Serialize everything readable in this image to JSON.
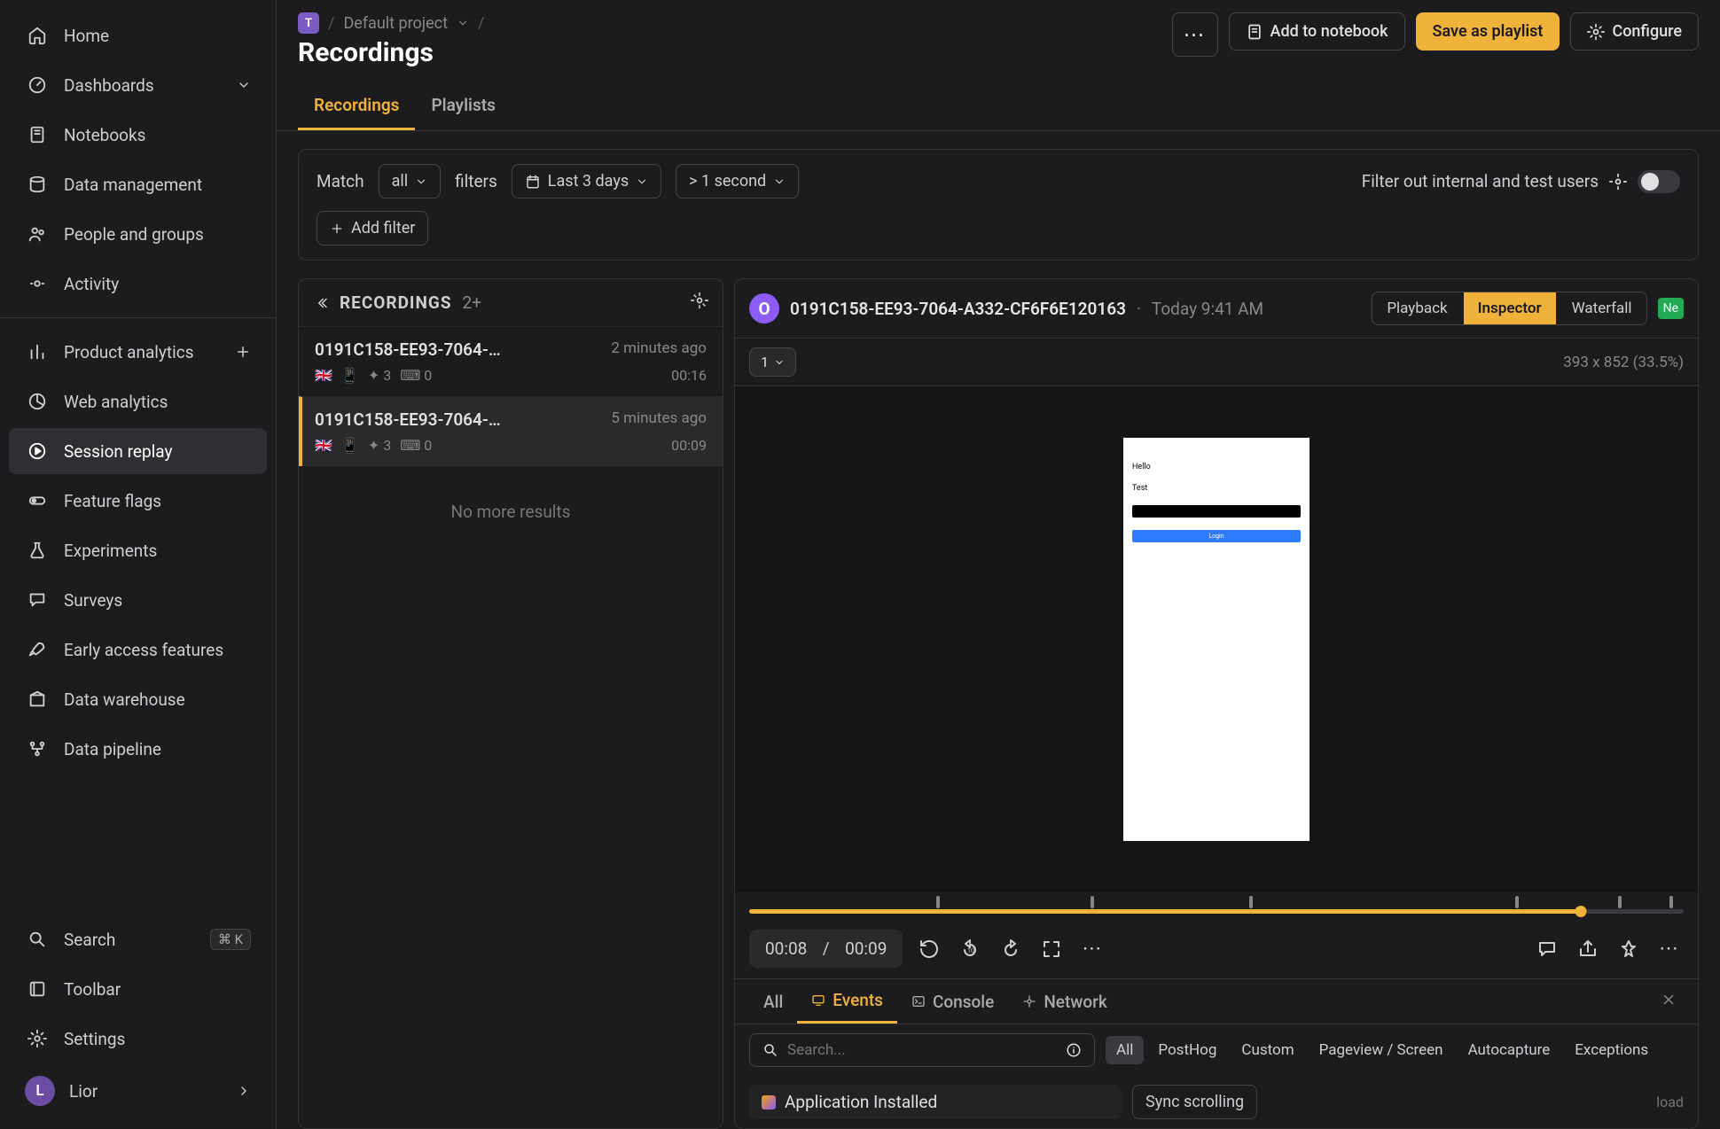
{
  "breadcrumb": {
    "project_chip": "T",
    "project_name": "Default project"
  },
  "page_title": "Recordings",
  "header_actions": {
    "more": "⋯",
    "add_notebook": "Add to notebook",
    "save_playlist": "Save as playlist",
    "configure": "Configure"
  },
  "tabs": {
    "recordings": "Recordings",
    "playlists": "Playlists"
  },
  "filters": {
    "match_label": "Match",
    "match_value": "all",
    "filters_label": "filters",
    "date_range": "Last 3 days",
    "duration": "> 1 second",
    "internal_label": "Filter out internal and test users",
    "add_filter": "Add filter"
  },
  "sidebar": {
    "items": [
      {
        "label": "Home",
        "icon": "home"
      },
      {
        "label": "Dashboards",
        "icon": "dash",
        "expand": true
      },
      {
        "label": "Notebooks",
        "icon": "notebook"
      },
      {
        "label": "Data management",
        "icon": "db"
      },
      {
        "label": "People and groups",
        "icon": "people"
      },
      {
        "label": "Activity",
        "icon": "activity"
      }
    ],
    "products": [
      {
        "label": "Product analytics",
        "icon": "bars",
        "plus": true
      },
      {
        "label": "Web analytics",
        "icon": "pie"
      },
      {
        "label": "Session replay",
        "icon": "play",
        "active": true
      },
      {
        "label": "Feature flags",
        "icon": "toggle"
      },
      {
        "label": "Experiments",
        "icon": "flask"
      },
      {
        "label": "Surveys",
        "icon": "chat"
      },
      {
        "label": "Early access features",
        "icon": "rocket"
      },
      {
        "label": "Data warehouse",
        "icon": "warehouse"
      },
      {
        "label": "Data pipeline",
        "icon": "pipeline"
      }
    ],
    "footer": {
      "search": "Search",
      "search_kbd": "⌘ K",
      "toolbar": "Toolbar",
      "settings": "Settings",
      "user": "Lior",
      "user_initial": "L"
    }
  },
  "recordings_panel": {
    "header": "RECORDINGS",
    "count": "2+",
    "no_more": "No more results",
    "items": [
      {
        "id": "0191C158-EE93-7064-…",
        "ago": "2 minutes ago",
        "flag": "🇬🇧",
        "device": "📱",
        "clicks": "3",
        "keys": "0",
        "dur": "00:16",
        "active": false
      },
      {
        "id": "0191C158-EE93-7064-…",
        "ago": "5 minutes ago",
        "flag": "🇬🇧",
        "device": "📱",
        "clicks": "3",
        "keys": "0",
        "dur": "00:09",
        "active": true
      }
    ]
  },
  "player": {
    "person_initial": "O",
    "rec_id": "0191C158-EE93-7064-A332-CF6F6E120163",
    "rec_sep": "·",
    "rec_time": "Today 9:41 AM",
    "view_tabs": {
      "playback": "Playback",
      "inspector": "Inspector",
      "waterfall": "Waterfall",
      "network_badge": "Ne"
    },
    "speed": "1",
    "dims": "393 x 852 (33.5%)",
    "phone": {
      "hello": "Hello",
      "test": "Test",
      "login": "Login"
    },
    "time_cur": "00:08",
    "time_sep": "/",
    "time_tot": "00:09",
    "progress_pct": 89,
    "ticks_pct": [
      20,
      36.5,
      53.5,
      82,
      93,
      98.5
    ]
  },
  "inspector": {
    "tabs": {
      "all": "All",
      "events": "Events",
      "console": "Console",
      "network": "Network"
    },
    "search_placeholder": "Search...",
    "pills": [
      "All",
      "PostHog",
      "Custom",
      "Pageview / Screen",
      "Autocapture",
      "Exceptions"
    ],
    "event0": "Application Installed",
    "sync": "Sync scrolling",
    "load": "load"
  }
}
